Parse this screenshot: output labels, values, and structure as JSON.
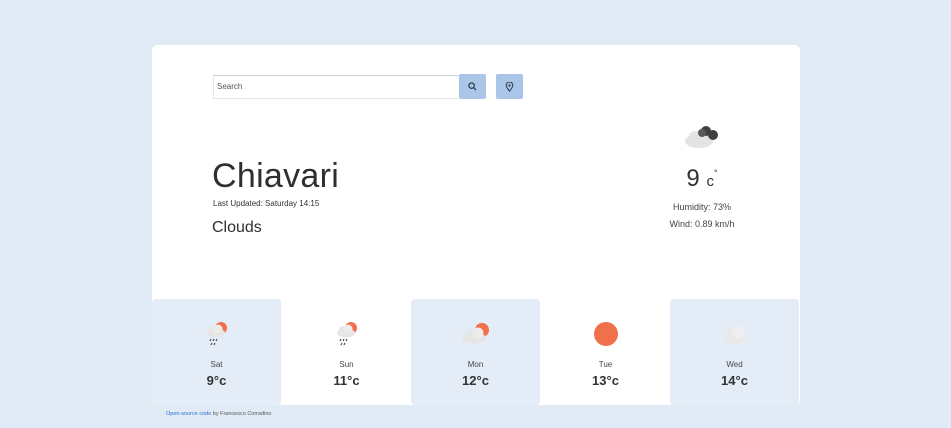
{
  "search": {
    "placeholder": "Search"
  },
  "current": {
    "city": "Chiavari",
    "updated": "Last Updated: Saturday 14:15",
    "description": "Clouds",
    "temp": "9",
    "unit": "c",
    "degree": "°",
    "humidity": "Humidity: 73%",
    "wind": "Wind: 0.89 km/h",
    "icon": "dark-cloud-icon"
  },
  "forecast": [
    {
      "day": "Sat",
      "temp": "9°c",
      "icon": "rain-sun-cloud-icon"
    },
    {
      "day": "Sun",
      "temp": "11°c",
      "icon": "rain-sun-cloud-icon"
    },
    {
      "day": "Mon",
      "temp": "12°c",
      "icon": "sun-cloud-icon"
    },
    {
      "day": "Tue",
      "temp": "13°c",
      "icon": "sun-icon"
    },
    {
      "day": "Wed",
      "temp": "14°c",
      "icon": "cloud-icon"
    }
  ],
  "footer": {
    "link": "Open-source code",
    "by": " by Francesco Corradino"
  },
  "colors": {
    "background": "#e1ebf5",
    "button": "#a9c6e8",
    "sun": "#f0704b",
    "shade": "#e4edf7"
  }
}
